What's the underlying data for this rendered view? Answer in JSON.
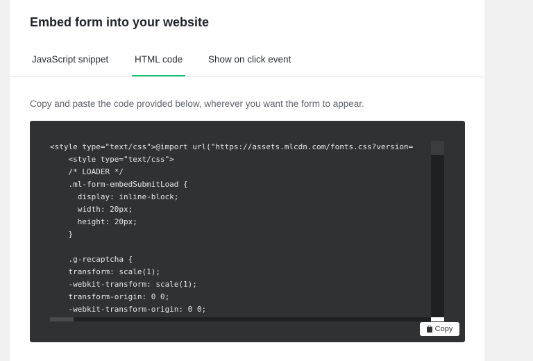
{
  "header": {
    "title": "Embed form into your website"
  },
  "tabs": [
    {
      "label": "JavaScript snippet",
      "active": false
    },
    {
      "label": "HTML code",
      "active": true
    },
    {
      "label": "Show on click event",
      "active": false
    }
  ],
  "main": {
    "description": "Copy and paste the code provided below, wherever you want the form to appear.",
    "code_text": "<style type=\"text/css\">@import url(\"https://assets.mlcdn.com/fonts.css?version=\n    <style type=\"text/css\">\n    /* LOADER */\n    .ml-form-embedSubmitLoad {\n      display: inline-block;\n      width: 20px;\n      height: 20px;\n    }\n\n    .g-recaptcha {\n    transform: scale(1);\n    -webkit-transform: scale(1);\n    transform-origin: 0 0;\n    -webkit-transform-origin: 0 0;",
    "copy_label": "Copy"
  },
  "colors": {
    "accent": "#09c269",
    "code_background": "#2f3133",
    "page_background": "#f0f0f1"
  },
  "icons": {
    "copy": "clipboard-icon"
  }
}
